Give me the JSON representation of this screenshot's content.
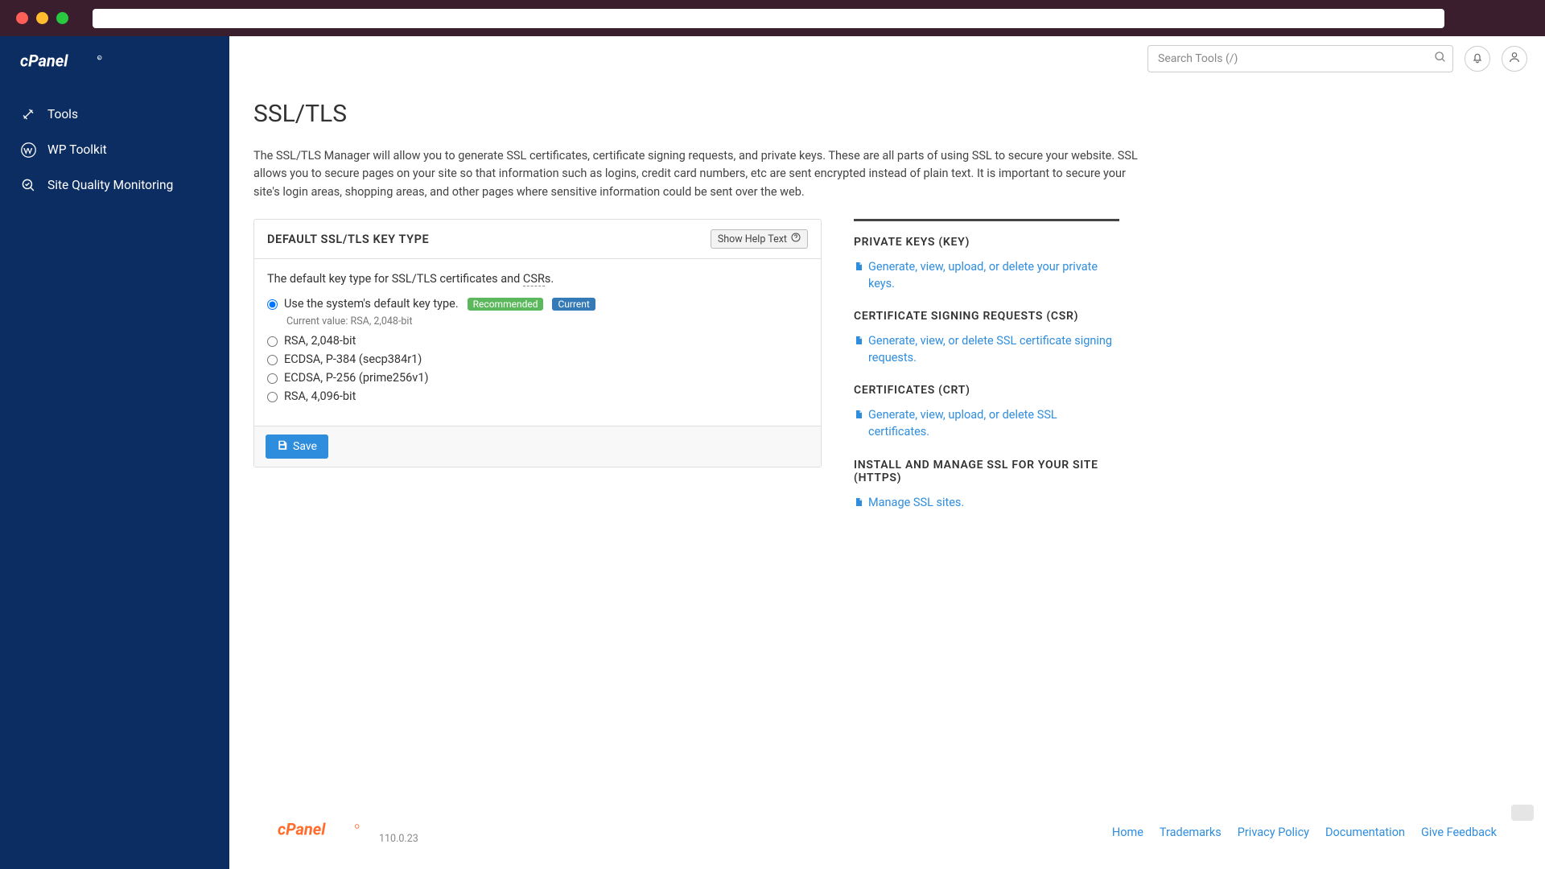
{
  "brand": "cPanel",
  "sidebar": {
    "items": [
      {
        "label": "Tools"
      },
      {
        "label": "WP Toolkit"
      },
      {
        "label": "Site Quality Monitoring"
      }
    ]
  },
  "header": {
    "search_placeholder": "Search Tools (/)"
  },
  "page": {
    "title": "SSL/TLS",
    "description": "The SSL/TLS Manager will allow you to generate SSL certificates, certificate signing requests, and private keys. These are all parts of using SSL to secure your website. SSL allows you to secure pages on your site so that information such as logins, credit card numbers, etc are sent encrypted instead of plain text. It is important to secure your site's login areas, shopping areas, and other pages where sensitive information could be sent over the web."
  },
  "card": {
    "title": "DEFAULT SSL/TLS KEY TYPE",
    "help_button": "Show Help Text",
    "subtext_prefix": "The default key type for SSL/TLS certificates and ",
    "subtext_abbr": "CSR",
    "subtext_suffix": "s.",
    "options": [
      {
        "label": "Use the system's default key type.",
        "checked": true,
        "recommended": "Recommended",
        "current": "Current"
      },
      {
        "label": "RSA, 2,048-bit",
        "checked": false
      },
      {
        "label": "ECDSA, P-384 (secp384r1)",
        "checked": false
      },
      {
        "label": "ECDSA, P-256 (prime256v1)",
        "checked": false
      },
      {
        "label": "RSA, 4,096-bit",
        "checked": false
      }
    ],
    "current_value": "Current value: RSA, 2,048-bit",
    "save_button": "Save"
  },
  "right": {
    "sections": [
      {
        "title": "PRIVATE KEYS (KEY)",
        "link": "Generate, view, upload, or delete your private keys."
      },
      {
        "title": "CERTIFICATE SIGNING REQUESTS (CSR)",
        "link": "Generate, view, or delete SSL certificate signing requests."
      },
      {
        "title": "CERTIFICATES (CRT)",
        "link": "Generate, view, upload, or delete SSL certificates."
      },
      {
        "title": "INSTALL AND MANAGE SSL FOR YOUR SITE (HTTPS)",
        "link": "Manage SSL sites."
      }
    ]
  },
  "footer": {
    "version": "110.0.23",
    "links": [
      "Home",
      "Trademarks",
      "Privacy Policy",
      "Documentation",
      "Give Feedback"
    ]
  }
}
